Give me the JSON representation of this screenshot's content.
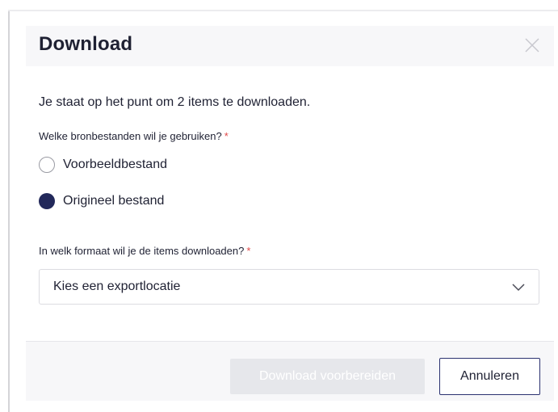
{
  "dialog": {
    "title": "Download",
    "close_icon": "close-icon",
    "intro": "Je staat op het punt om 2 items te downloaden."
  },
  "source_files": {
    "label": "Welke bronbestanden wil je gebruiken?",
    "required_marker": "*",
    "options": [
      {
        "label": "Voorbeeldbestand",
        "selected": false
      },
      {
        "label": "Origineel bestand",
        "selected": true
      }
    ]
  },
  "format": {
    "label": "In welk formaat wil je de items downloaden?",
    "required_marker": "*",
    "select_value": "Kies een exportlocatie",
    "chevron_icon": "chevron-down-icon"
  },
  "footer": {
    "primary_label": "Download voorbereiden",
    "primary_disabled": true,
    "secondary_label": "Annuleren"
  },
  "colors": {
    "radio_selected": "#22285a",
    "required_marker": "#e04848",
    "header_background": "#f7f7f9",
    "disabled_button": "#e6e7eb",
    "secondary_button_border": "#2b3170"
  }
}
